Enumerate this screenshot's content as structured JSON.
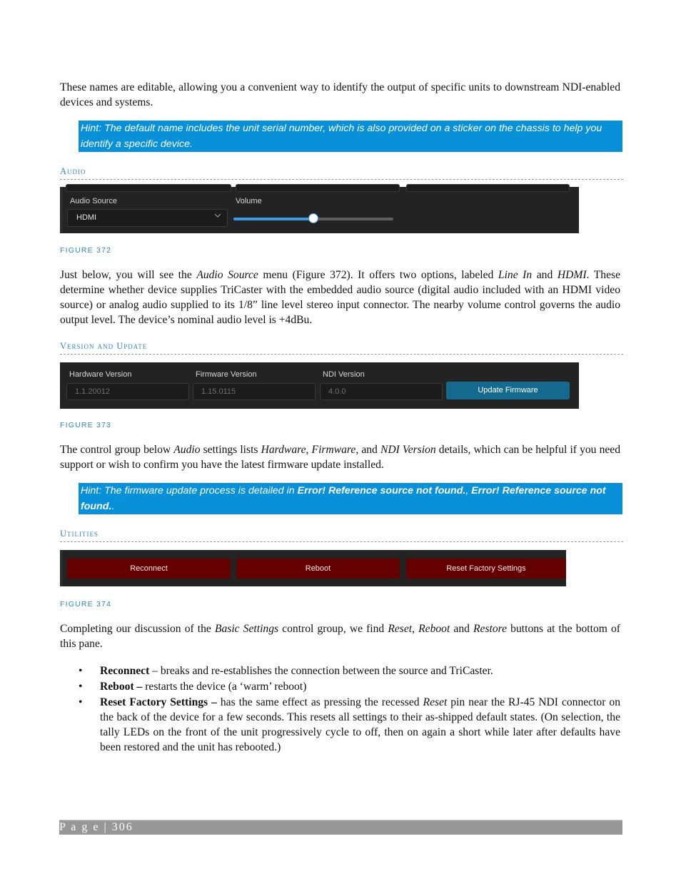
{
  "intro": {
    "text": "These names are editable, allowing you a convenient way to identify the output of specific units to downstream NDI-enabled devices and systems."
  },
  "hint1": {
    "text": "Hint:  The default name includes the unit serial number, which is also provided on a sticker on the chassis to help you identify a specific device."
  },
  "audio_section": {
    "heading": "Audio",
    "figure": {
      "caption": "FIGURE 372",
      "audio_source_label": "Audio Source",
      "audio_source_value": "HDMI",
      "volume_label": "Volume",
      "volume_level": 0.5
    },
    "paragraph": {
      "p1": "Just below, you will see the ",
      "i1": "Audio Source",
      "p2": " menu (Figure 372).  It offers two options, labeled ",
      "i2": "Line In",
      "p3": " and ",
      "i3": "HDMI",
      "p4": ". These determine whether device supplies TriCaster with the embedded audio source (digital audio included with an HDMI video source) or analog audio supplied to its 1/8” line level stereo input connector.  The nearby volume control governs the audio output level.  The device’s nominal audio level is +4dBu."
    }
  },
  "version_section": {
    "heading": "Version and Update",
    "figure": {
      "caption": "FIGURE 373",
      "hardware_label": "Hardware Version",
      "hardware_value": "1.1.20012",
      "firmware_label": "Firmware Version",
      "firmware_value": "1.15.0115",
      "ndi_label": "NDI Version",
      "ndi_value": "4.0.0",
      "update_button": "Update Firmware"
    },
    "paragraph": {
      "p1": "The control group below ",
      "i1": "Audio",
      "p2": " settings lists ",
      "i2": "Hardware",
      "p3": ", ",
      "i3": "Firmware",
      "p4": ", and ",
      "i4": "NDI Version",
      "p5": " details, which can be helpful if you need support or wish to confirm you have the latest firmware update installed."
    }
  },
  "hint2": {
    "p1": "Hint: The firmware update process is detailed in ",
    "b1": "Error! Reference source not found.",
    "p2": ", ",
    "b2": "Error! Reference source not found.",
    "p3": "."
  },
  "utilities_section": {
    "heading": "Utilities",
    "figure": {
      "caption": "FIGURE 374",
      "buttons": [
        "Reconnect",
        "Reboot",
        "Reset Factory Settings"
      ]
    },
    "paragraph": {
      "p1": "Completing our discussion of the ",
      "i1": "Basic Settings",
      "p2": " control group, we find ",
      "i2": "Reset",
      "p3": ", ",
      "i3": "Reboot",
      "p4": " and ",
      "i4": "Restore",
      "p5": " buttons at the bottom of this pane."
    },
    "bullets": [
      {
        "term": "Reconnect",
        "text": " – breaks and re-establishes the connection between the source and TriCaster."
      },
      {
        "term": "Reboot –",
        "text": " restarts the device (a ‘warm’ reboot)"
      },
      {
        "term": "Reset Factory Settings –",
        "text_a": " has the same effect as pressing the recessed ",
        "italic": "Reset",
        "text_b": " pin near the RJ-45 NDI connector on the back of the device for a few seconds.  This resets all settings to their as-shipped default states.  (On selection, the tally LEDs on the front of the unit progressively cycle to off, then on again a short while later after defaults have been restored and the unit has rebooted.)"
      }
    ],
    "bullet_glyph": "•"
  },
  "footer": {
    "page_label": "P a g e  |  306"
  },
  "colors": {
    "hint_bg": "#0891d8",
    "heading_accent": "#2e86c8",
    "slider_fill": "#3f9ae8",
    "update_button": "#146a8e",
    "utility_button": "#640000",
    "panel_bg": "#232323",
    "footer_bg": "#979797"
  }
}
